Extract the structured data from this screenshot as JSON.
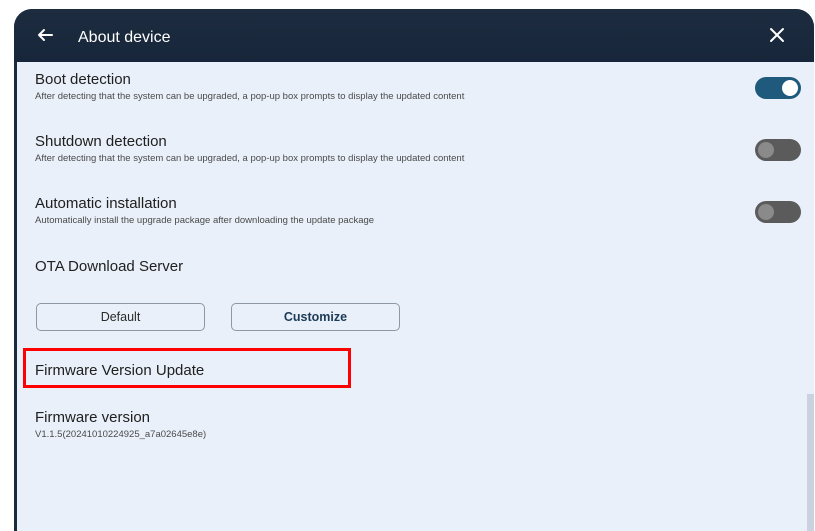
{
  "header": {
    "title": "About device",
    "back_icon": "arrow-left-icon",
    "close_icon": "close-icon"
  },
  "settings": [
    {
      "name": "Boot detection",
      "description": "After detecting that the system can be upgraded, a pop-up box prompts to display the updated content",
      "enabled": true
    },
    {
      "name": "Shutdown detection",
      "description": "After detecting that the system can be upgraded, a pop-up box prompts to display the updated content",
      "enabled": false
    },
    {
      "name": "Automatic installation",
      "description": "Automatically install the upgrade package after downloading the update package",
      "enabled": false
    }
  ],
  "ota": {
    "title": "OTA Download Server",
    "options": [
      "Default",
      "Customize"
    ],
    "selected": "Customize"
  },
  "firmware_update": {
    "label": "Firmware Version Update"
  },
  "firmware_version": {
    "label": "Firmware version",
    "value": "V1.1.5(20241010224925_a7a02645e8e)"
  },
  "colors": {
    "header_bg": "#1b2a3c",
    "content_bg": "#e9f0f9",
    "toggle_on": "#1f5a7c",
    "toggle_off": "#5b5b5b",
    "highlight": "#ff0000"
  }
}
